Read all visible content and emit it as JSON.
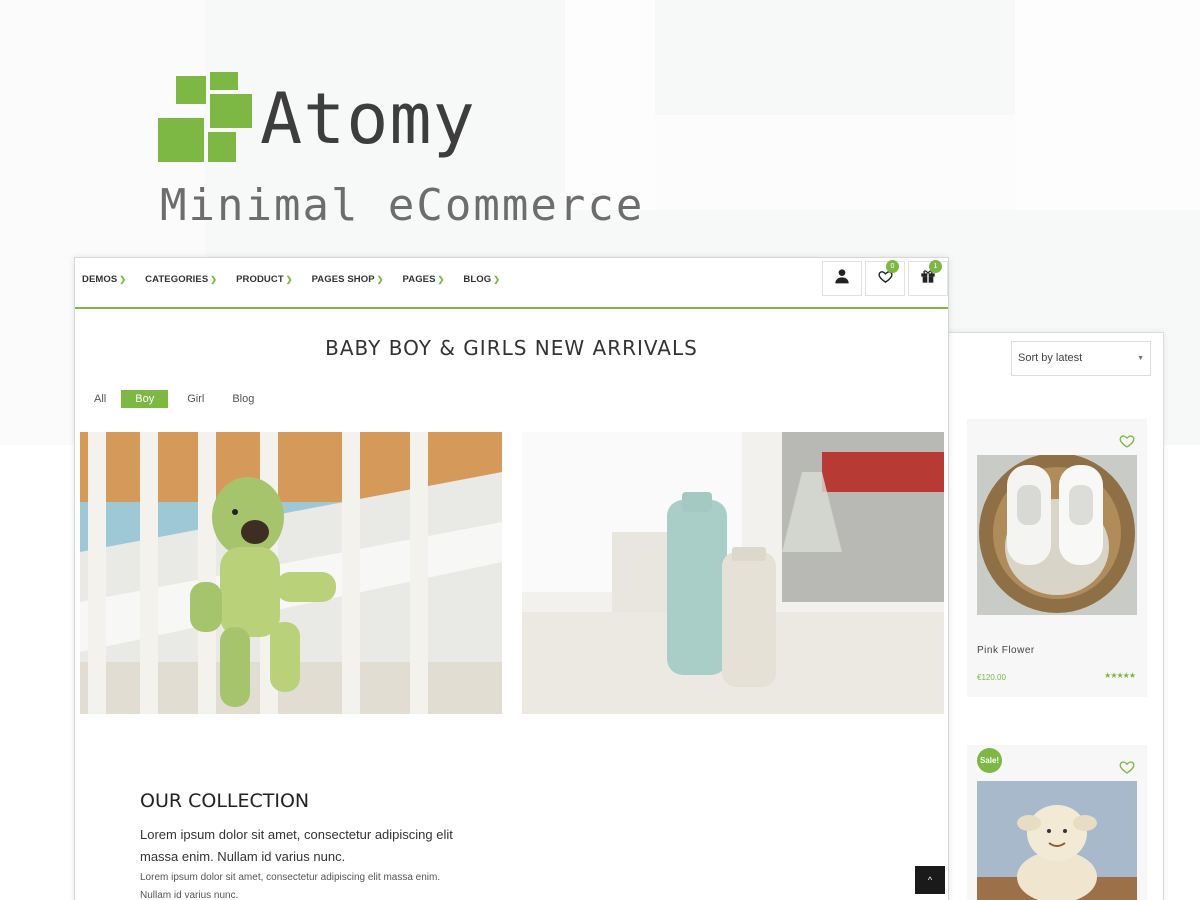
{
  "brand": {
    "name": "Atomy",
    "tagline": "Minimal eCommerce",
    "accent_color": "#7cb843"
  },
  "nav": {
    "items": [
      {
        "label": "DEMOS"
      },
      {
        "label": "CATEGORIES"
      },
      {
        "label": "PRODUCT"
      },
      {
        "label": "PAGES SHOP"
      },
      {
        "label": "PAGES"
      },
      {
        "label": "BLOG"
      }
    ],
    "icons": {
      "account": "user-icon",
      "wishlist": "heart-icon",
      "wishlist_count": "0",
      "cart": "gift-cart-icon",
      "cart_count": "1"
    }
  },
  "main": {
    "section_title": "BABY BOY & GIRLS NEW ARRIVALS",
    "filters": [
      "All",
      "Boy",
      "Girl",
      "Blog"
    ],
    "active_filter": "Boy",
    "collection": {
      "title": "OUR COLLECTION",
      "lead": "Lorem ipsum dolor sit amet, consectetur adipiscing elit massa enim. Nullam id varius nunc.",
      "body": "Lorem ipsum dolor sit amet, consectetur adipiscing elit massa enim. Nullam id varius nunc."
    },
    "back_to_top": "^"
  },
  "shop": {
    "sort": {
      "selected": "Sort by latest"
    },
    "products": [
      {
        "name": "Pink Flower",
        "price": "€120.00",
        "rating": "★★★★★",
        "sale": null
      },
      {
        "name": "",
        "price": "",
        "rating": "",
        "sale": "Sale!"
      }
    ]
  }
}
